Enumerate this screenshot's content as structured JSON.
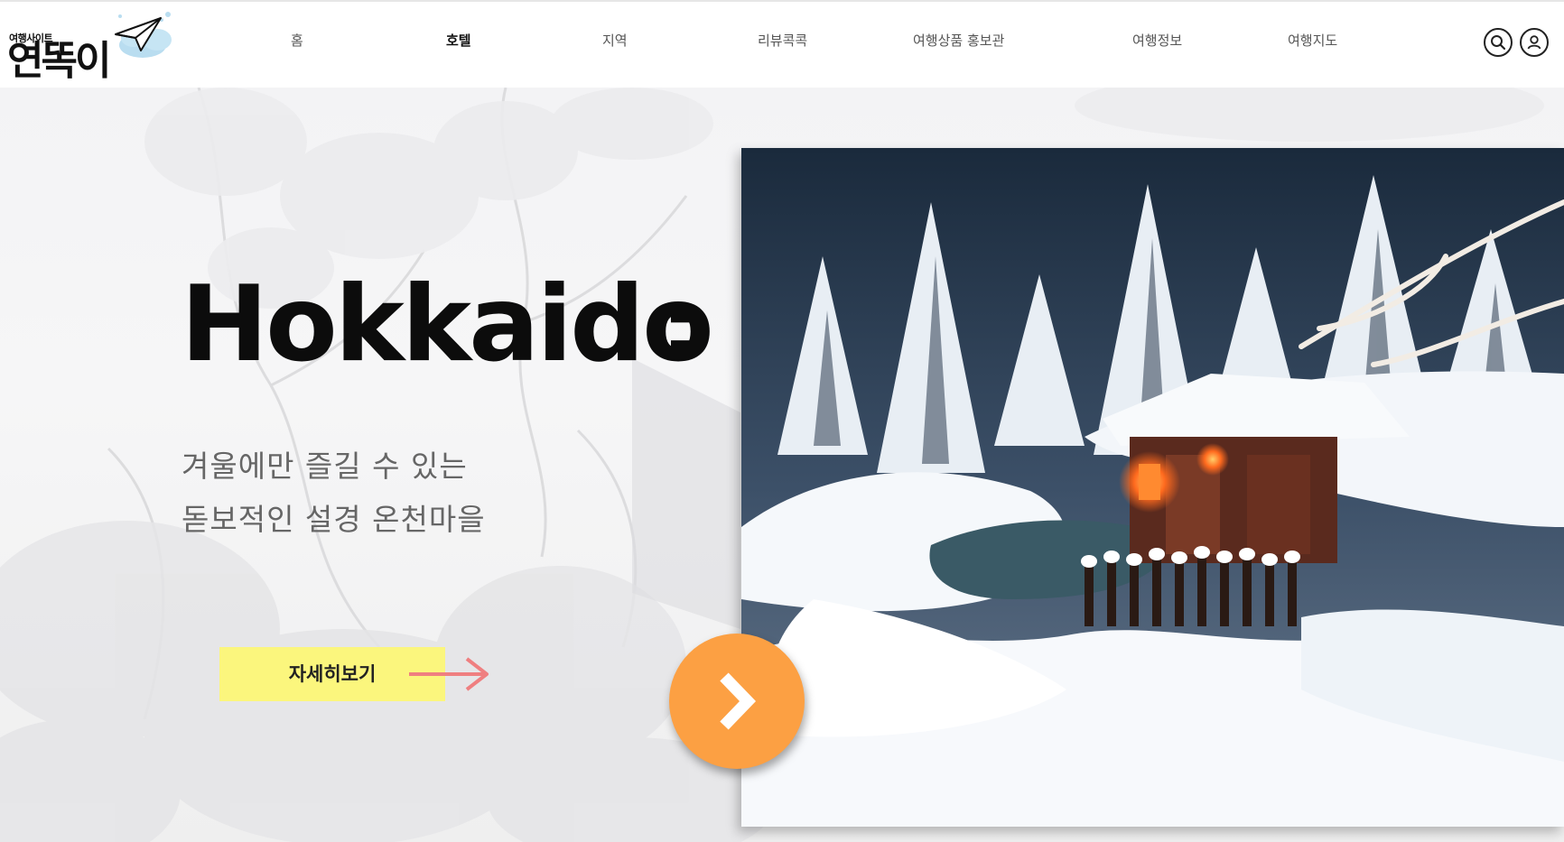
{
  "logo": {
    "small_text": "여행사이트",
    "big_text": "연똑이",
    "icon": "paper-plane-icon"
  },
  "nav": {
    "items": [
      {
        "label": "홈"
      },
      {
        "label": "호텔"
      },
      {
        "label": "지역"
      },
      {
        "label": "리뷰콕콕"
      },
      {
        "label": "여행상품 홍보관"
      },
      {
        "label": "여행정보"
      },
      {
        "label": "여행지도"
      }
    ],
    "active": "호텔"
  },
  "header_icons": {
    "search": "search-icon",
    "user": "user-icon"
  },
  "hero": {
    "title": "Hokkaido",
    "title_suffix": ":",
    "subtitle_line1": "겨울에만 즐길 수 있는",
    "subtitle_line2": "돋보적인 설경 온천마을",
    "cta_label": "자세히보기",
    "next_icon": "chevron-right-icon"
  },
  "colors": {
    "cta_bg": "#fbf67d",
    "cta_arrow": "#ef7f80",
    "next_button": "#fca043",
    "title": "#0c0c0c",
    "subtitle": "#666666"
  }
}
